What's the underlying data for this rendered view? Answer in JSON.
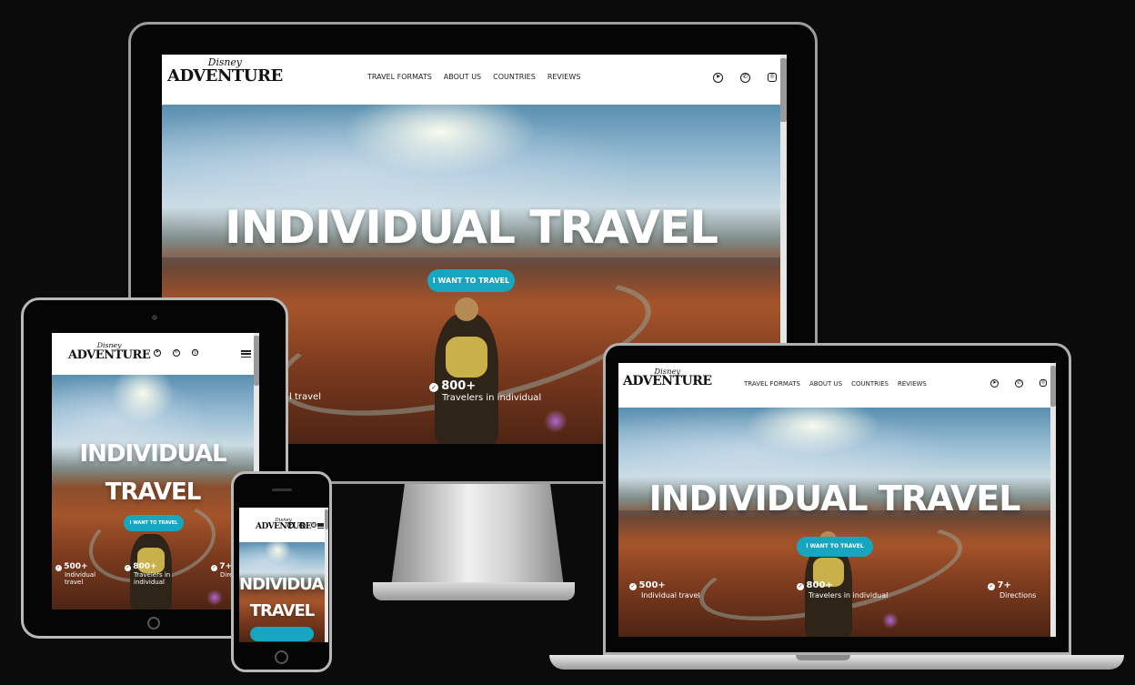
{
  "brand": {
    "top": "Disney",
    "bottom": "ADVENTURE"
  },
  "nav": [
    "TRAVEL FORMATS",
    "ABOUT US",
    "COUNTRIES",
    "REVIEWS"
  ],
  "social_icons": [
    "telegram-icon",
    "whatsapp-icon",
    "instagram-icon"
  ],
  "hero": {
    "title": "INDIVIDUAL TRAVEL",
    "title_line1": "INDIVIDUAL",
    "title_line2": "TRAVEL",
    "phone_line1": "NDIVIDUAI",
    "cta": "I WANT TO TRAVEL"
  },
  "stats": [
    {
      "value": "500+",
      "label": "Individual travel"
    },
    {
      "value": "800+",
      "label": "Travelers in individual"
    },
    {
      "value": "7+",
      "label": "Directions"
    }
  ],
  "tablet_stats": [
    {
      "value": "500+",
      "label1": "Individual",
      "label2": "travel"
    },
    {
      "value": "800+",
      "label1": "Travelers in",
      "label2": "individual"
    },
    {
      "value": "7+",
      "label1": "Direc",
      "label2": ""
    }
  ],
  "desktop_partial_label": "l travel",
  "colors": {
    "accent": "#17a6bf",
    "background": "#0c0b0c"
  }
}
